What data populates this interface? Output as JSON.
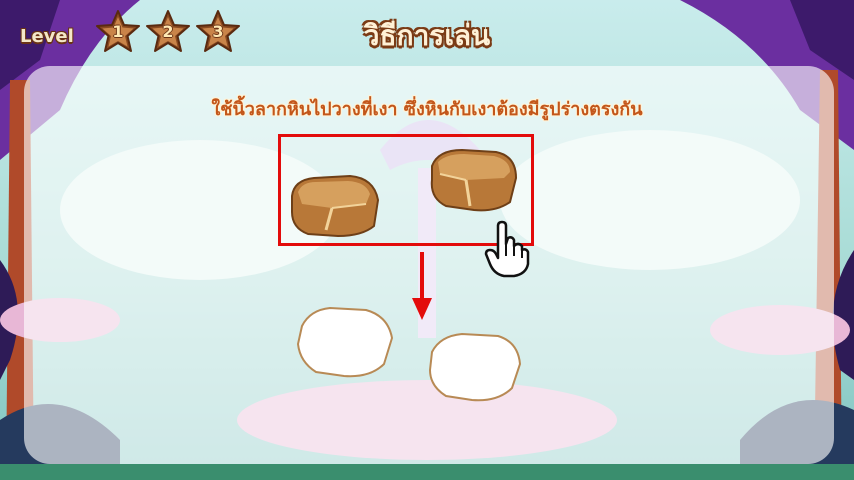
{
  "header": {
    "level_label": "Level",
    "levels": [
      "1",
      "2",
      "3"
    ],
    "title": "วิธีการเล่น"
  },
  "instruction": "ใช้นิ้วลากหินไปวางที่เงา ซึ่งหินกับเงาต้องมีรูปร่างตรงกัน",
  "icons": {
    "star": "star-icon",
    "hand": "pointing-hand-icon",
    "arrow": "arrow-down-icon"
  },
  "colors": {
    "highlight_border": "#e30b0b",
    "title_fill": "#fff1d6",
    "instruction_text": "#c3561a",
    "rock": "#c98b4c",
    "shadow_outline": "#b88a55"
  }
}
